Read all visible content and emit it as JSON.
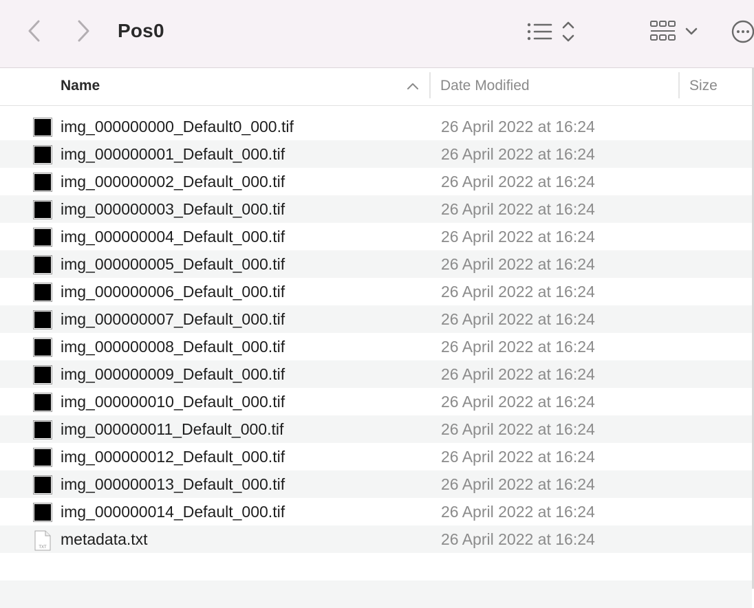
{
  "window": {
    "title": "Pos0",
    "icons": {
      "back": "chevron-left-icon",
      "forward": "chevron-right-icon",
      "list_view": "list-view-icon",
      "sort_toggle": "up-down-chevron-icon",
      "group_view": "grid-icon",
      "group_dropdown": "chevron-down-icon",
      "more": "ellipsis-circle-icon"
    }
  },
  "columns": {
    "name": "Name",
    "date_modified": "Date Modified",
    "size": "Size"
  },
  "files": [
    {
      "name": "img_000000000_Default0_000.tif",
      "date": "26 April 2022 at 16:24",
      "icon": "tif-thumbnail-icon"
    },
    {
      "name": "img_000000001_Default_000.tif",
      "date": "26 April 2022 at 16:24",
      "icon": "tif-thumbnail-icon"
    },
    {
      "name": "img_000000002_Default_000.tif",
      "date": "26 April 2022 at 16:24",
      "icon": "tif-thumbnail-icon"
    },
    {
      "name": "img_000000003_Default_000.tif",
      "date": "26 April 2022 at 16:24",
      "icon": "tif-thumbnail-icon"
    },
    {
      "name": "img_000000004_Default_000.tif",
      "date": "26 April 2022 at 16:24",
      "icon": "tif-thumbnail-icon"
    },
    {
      "name": "img_000000005_Default_000.tif",
      "date": "26 April 2022 at 16:24",
      "icon": "tif-thumbnail-icon"
    },
    {
      "name": "img_000000006_Default_000.tif",
      "date": "26 April 2022 at 16:24",
      "icon": "tif-thumbnail-icon"
    },
    {
      "name": "img_000000007_Default_000.tif",
      "date": "26 April 2022 at 16:24",
      "icon": "tif-thumbnail-icon"
    },
    {
      "name": "img_000000008_Default_000.tif",
      "date": "26 April 2022 at 16:24",
      "icon": "tif-thumbnail-icon"
    },
    {
      "name": "img_000000009_Default_000.tif",
      "date": "26 April 2022 at 16:24",
      "icon": "tif-thumbnail-icon"
    },
    {
      "name": "img_000000010_Default_000.tif",
      "date": "26 April 2022 at 16:24",
      "icon": "tif-thumbnail-icon"
    },
    {
      "name": "img_000000011_Default_000.tif",
      "date": "26 April 2022 at 16:24",
      "icon": "tif-thumbnail-icon"
    },
    {
      "name": "img_000000012_Default_000.tif",
      "date": "26 April 2022 at 16:24",
      "icon": "tif-thumbnail-icon"
    },
    {
      "name": "img_000000013_Default_000.tif",
      "date": "26 April 2022 at 16:24",
      "icon": "tif-thumbnail-icon"
    },
    {
      "name": "img_000000014_Default_000.tif",
      "date": "26 April 2022 at 16:24",
      "icon": "tif-thumbnail-icon"
    },
    {
      "name": "metadata.txt",
      "date": "26 April 2022 at 16:24",
      "icon": "txt-document-icon"
    }
  ],
  "colors": {
    "toolbar_bg": "#f7f2f6",
    "row_alt": "#f4f5f5",
    "date_text": "#8b8b8b"
  }
}
